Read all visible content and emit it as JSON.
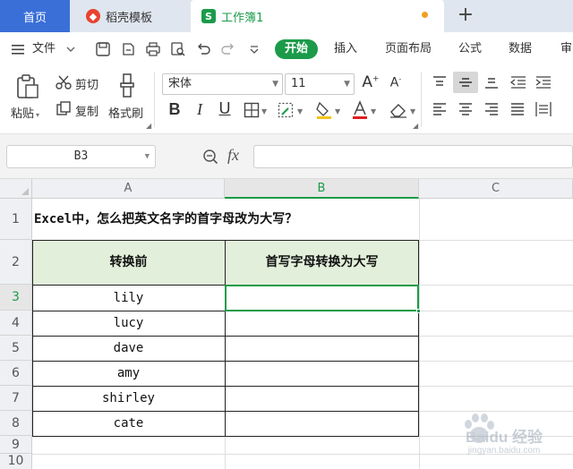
{
  "tabs": {
    "home": "首页",
    "templates": "稻壳模板",
    "doc": "工作簿1",
    "new_tab": "+"
  },
  "menu": {
    "file": "文件",
    "start": "开始",
    "insert": "插入",
    "page_layout": "页面布局",
    "formula": "公式",
    "data": "数据",
    "review_partial": "审"
  },
  "ribbon": {
    "paste": "粘贴",
    "cut": "剪切",
    "copy": "复制",
    "format_painter": "格式刷",
    "font_name": "宋体",
    "font_size": "11",
    "bold": "B",
    "italic": "I",
    "underline": "U"
  },
  "formula_bar": {
    "cell_ref": "B3",
    "fx": "fx",
    "content": ""
  },
  "grid": {
    "columns": [
      "A",
      "B",
      "C"
    ],
    "rows": [
      "1",
      "2",
      "3",
      "4",
      "5",
      "6",
      "7",
      "8",
      "9",
      "10"
    ],
    "title": "Excel中，怎么把英文名字的首字母改为大写？",
    "header_a": "转换前",
    "header_b": "首写字母转换为大写",
    "names": [
      "lily",
      "lucy",
      "dave",
      "amy",
      "shirley",
      "cate"
    ]
  },
  "watermark": {
    "text": "Baidu 经验",
    "url": "jingyan.baidu.com"
  },
  "colors": {
    "accent_green": "#1b9b4a",
    "home_tab": "#3a6fd8",
    "header_fill": "#e2efda"
  }
}
